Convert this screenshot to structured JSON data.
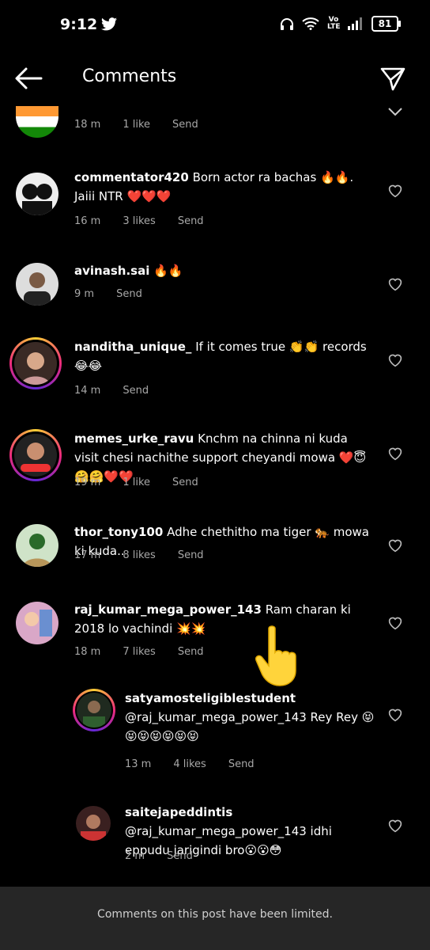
{
  "status": {
    "time": "9:12",
    "volte": "Vo LTE",
    "battery": "81"
  },
  "header": {
    "title": "Comments"
  },
  "comments": [
    {
      "username": "",
      "text": "",
      "time": "18 m",
      "likes": "1 like",
      "send": "Send"
    },
    {
      "username": "commentator420",
      "text": "Born actor ra bachas 🔥🔥. Jaiii NTR ❤️❤️❤️",
      "time": "16 m",
      "likes": "3 likes",
      "send": "Send"
    },
    {
      "username": "avinash.sai",
      "text": "🔥🔥",
      "time": "9 m",
      "likes": "",
      "send": "Send"
    },
    {
      "username": "nanditha_unique_",
      "text": "If it comes true 👏👏 records 😂😂",
      "time": "14 m",
      "likes": "",
      "send": "Send"
    },
    {
      "username": "memes_urke_ravu",
      "text": "Knchm na chinna ni kuda visit chesi nachithe support cheyandi mowa ❤️😇🤗🤗❤️❤️",
      "time": "19 m",
      "likes": "1 like",
      "send": "Send"
    },
    {
      "username": "thor_tony100",
      "text": "Adhe chethitho ma tiger 🐅 mowa ki kuda..",
      "time": "17 m",
      "likes": "8 likes",
      "send": "Send"
    },
    {
      "username": "raj_kumar_mega_power_143",
      "text": "Ram charan ki 2018 lo vachindi 💥💥",
      "time": "18 m",
      "likes": "7 likes",
      "send": "Send"
    },
    {
      "username": "satyamosteligiblestudent",
      "text": "@raj_kumar_mega_power_143 Rey Rey 😝😝😝😝😝😝😝",
      "time": "13 m",
      "likes": "4 likes",
      "send": "Send"
    },
    {
      "username": "saitejapeddintis",
      "text": "@raj_kumar_mega_power_143 idhi eppudu jarigindi bro😮😮😳",
      "time": "2 m",
      "likes": "",
      "send": "Send"
    }
  ],
  "footer": {
    "text": "Comments on this post have been limited."
  },
  "colors": {
    "background": "#000000",
    "meta_text": "#a8a8a8",
    "footer_bg": "#262626"
  },
  "icons": [
    "back-arrow-icon",
    "direct-send-icon",
    "heart-icon",
    "twitter-icon",
    "wifi-icon",
    "signal-icon",
    "headphones-icon",
    "pointing-hand-icon"
  ]
}
